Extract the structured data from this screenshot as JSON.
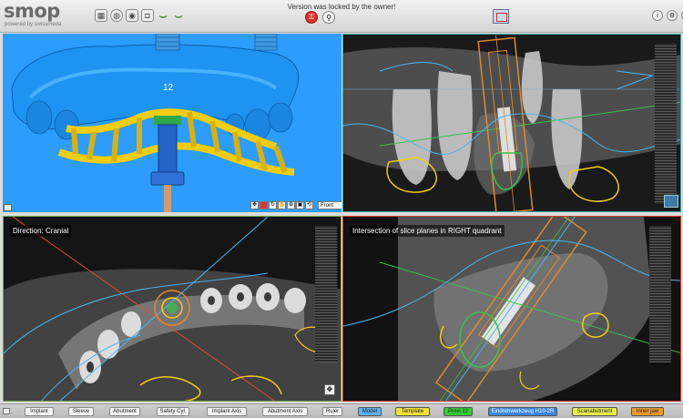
{
  "header": {
    "logo": "smop",
    "logo_sub": "powered by swissmeda",
    "status_message": "Version was locked by the owner!",
    "tool_icons": [
      "grid-icon",
      "tooth-icon",
      "eye-icon",
      "camera-icon",
      "jaw-upper-icon",
      "jaw-lower-icon"
    ],
    "lock_icons": [
      "lock-icon",
      "unlock-icon"
    ],
    "layout_icon": "layout-icon",
    "window_icons": [
      "info-icon",
      "settings-icon",
      "close-icon"
    ]
  },
  "panels": {
    "view3d": {
      "implant_number": "12",
      "view_select_value": "Front",
      "controls": [
        "move-icon",
        "delete-icon",
        "rotate-icon",
        "pan-icon",
        "zoom-icon",
        "fit-icon",
        "reset-icon"
      ]
    },
    "sagittal": {
      "label": ""
    },
    "axial": {
      "label": "Direction: Cranial"
    },
    "cross": {
      "label": "Intersection of slice planes in RIGHT quadrant"
    }
  },
  "toolbar": {
    "buttons": [
      {
        "label": "Implant",
        "bg": "#f4f4f4"
      },
      {
        "label": "Sleeve",
        "bg": "#f4f4f4"
      },
      {
        "label": "Abutment",
        "bg": "#f4f4f4"
      },
      {
        "label": "Safety Cyl.",
        "bg": "#f4f4f4"
      },
      {
        "label": "Implant Axis",
        "bg": "#f4f4f4"
      },
      {
        "label": "Abutment Axis",
        "bg": "#f4f4f4"
      },
      {
        "label": "Ruler",
        "bg": "#f4f4f4"
      },
      {
        "label": "Model",
        "bg": "#5eb1f0"
      },
      {
        "label": "Template",
        "bg": "#f0e23a"
      },
      {
        "label": "Provi 12",
        "bg": "#33cc33"
      },
      {
        "label": "Eindrehwerkzeug H10-2R",
        "bg": "#3a86e0"
      },
      {
        "label": "Scanabutment",
        "bg": "#e8ee4a"
      },
      {
        "label": "Inner jaw",
        "bg": "#e89a2a"
      }
    ]
  },
  "colors": {
    "background_3d": "#2c9dfd",
    "template_yellow": "#f2cd12",
    "implant_blue": "#2464c8",
    "outline_cyan": "#46b6f0",
    "outline_orange": "#e08a2a",
    "outline_green": "#39c24a",
    "panel_border_axial": "#6fa84a",
    "panel_border_cross": "#d13b2b"
  }
}
